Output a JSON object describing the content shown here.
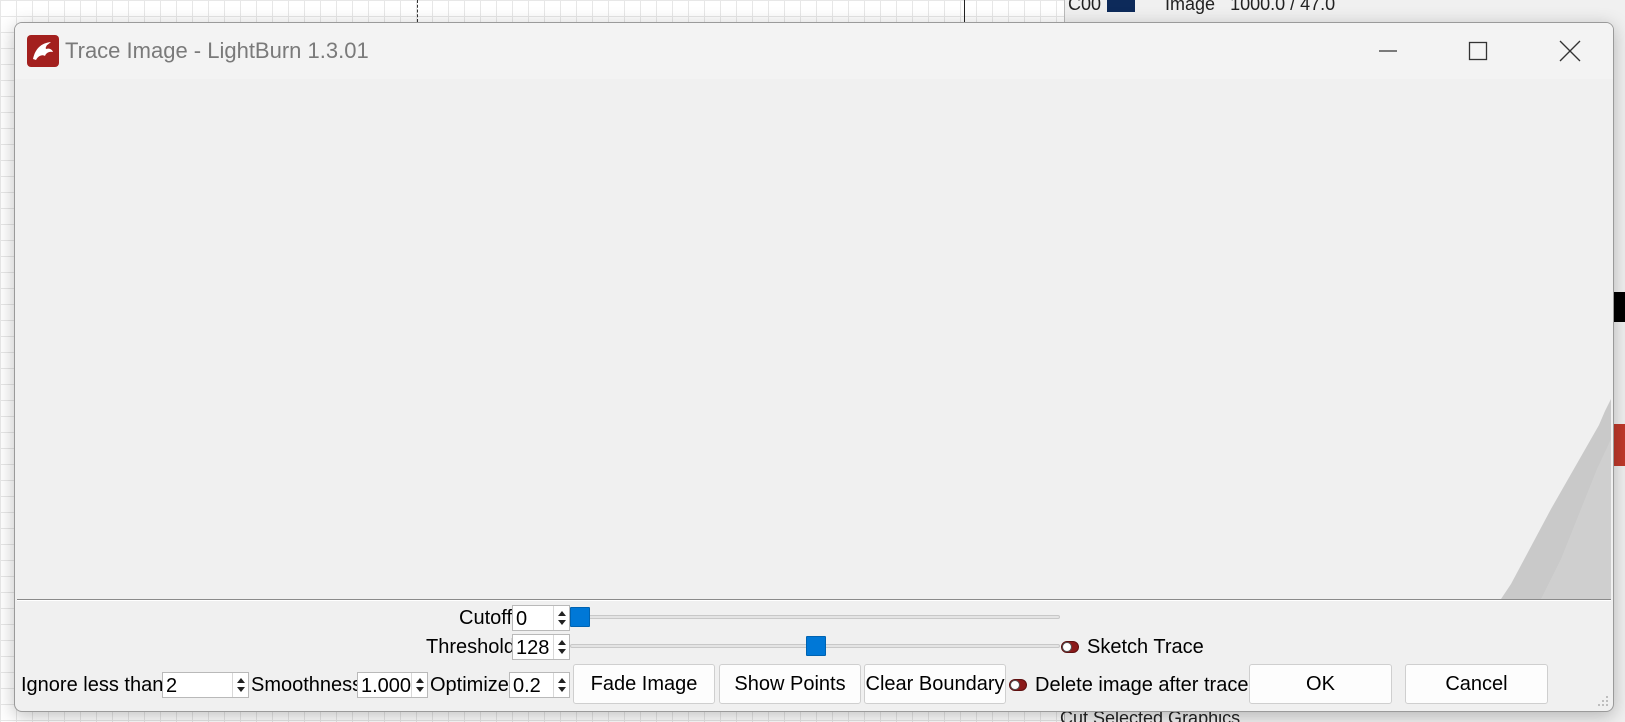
{
  "window": {
    "title": "Trace Image - LightBurn 1.3.01"
  },
  "background": {
    "layer_row": "C00",
    "layer_type": "Image",
    "layer_values": "1000.0 / 47.0",
    "bottom_item": "Cut Selected Graphics"
  },
  "controls": {
    "cutoff": {
      "label": "Cutoff",
      "value": "0",
      "level_0_255": 0
    },
    "threshold": {
      "label": "Threshold",
      "value": "128",
      "level_0_255": 128
    },
    "sketch_trace": {
      "label": "Sketch Trace",
      "checked": false
    },
    "ignore_less_than": {
      "label": "Ignore less than",
      "value": "2"
    },
    "smoothness": {
      "label": "Smoothness",
      "value": "1.000"
    },
    "optimize": {
      "label": "Optimize",
      "value": "0.2"
    },
    "delete_image": {
      "label": "Delete image after trace",
      "checked": false
    }
  },
  "buttons": {
    "fade_image": "Fade Image",
    "show_points": "Show Points",
    "clear_boundary": "Clear Boundary",
    "ok": "OK",
    "cancel": "Cancel"
  },
  "colors": {
    "accent": "#0078d7",
    "brand": "#a3201e",
    "toggle_off": "#8b1a1a"
  }
}
